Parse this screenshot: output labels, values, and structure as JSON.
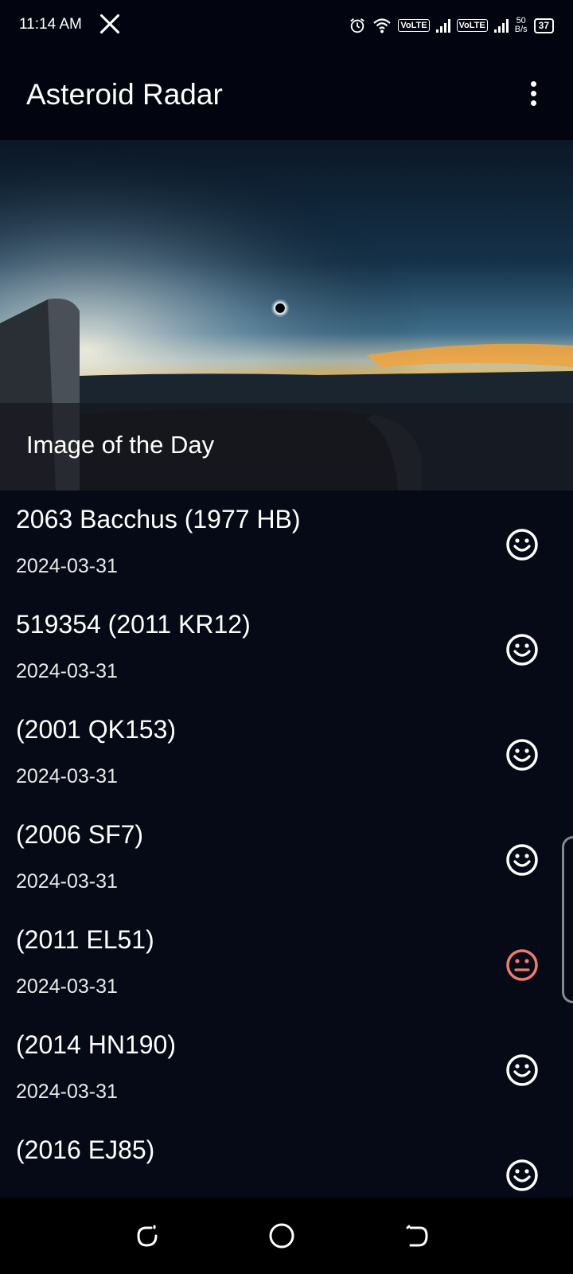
{
  "status_bar": {
    "time": "11:14 AM",
    "network_1": "VoLTE",
    "network_2": "VoLTE",
    "speed_value": "50",
    "speed_unit": "B/s",
    "battery": "37"
  },
  "app_bar": {
    "title": "Asteroid Radar"
  },
  "hero": {
    "caption": "Image of the Day"
  },
  "asteroids": [
    {
      "name": "2063 Bacchus (1977 HB)",
      "date": "2024-03-31",
      "hazard": "safe"
    },
    {
      "name": "519354 (2011 KR12)",
      "date": "2024-03-31",
      "hazard": "safe"
    },
    {
      "name": "(2001 QK153)",
      "date": "2024-03-31",
      "hazard": "safe"
    },
    {
      "name": "(2006 SF7)",
      "date": "2024-03-31",
      "hazard": "safe"
    },
    {
      "name": "(2011 EL51)",
      "date": "2024-03-31",
      "hazard": "potentially-hazardous"
    },
    {
      "name": "(2014 HN190)",
      "date": "2024-03-31",
      "hazard": "safe"
    },
    {
      "name": "(2016 EJ85)",
      "date": "",
      "hazard": "safe"
    }
  ],
  "colors": {
    "background": "#050a16",
    "safe_icon": "#ffffff",
    "hazard_icon": "#f07a6f"
  },
  "icons": {
    "safe": "happy-face-icon",
    "hazard": "neutral-face-icon",
    "menu": "more-vert-icon",
    "nav_recent": "recent-apps-icon",
    "nav_home": "home-circle-icon",
    "nav_back": "back-icon"
  }
}
